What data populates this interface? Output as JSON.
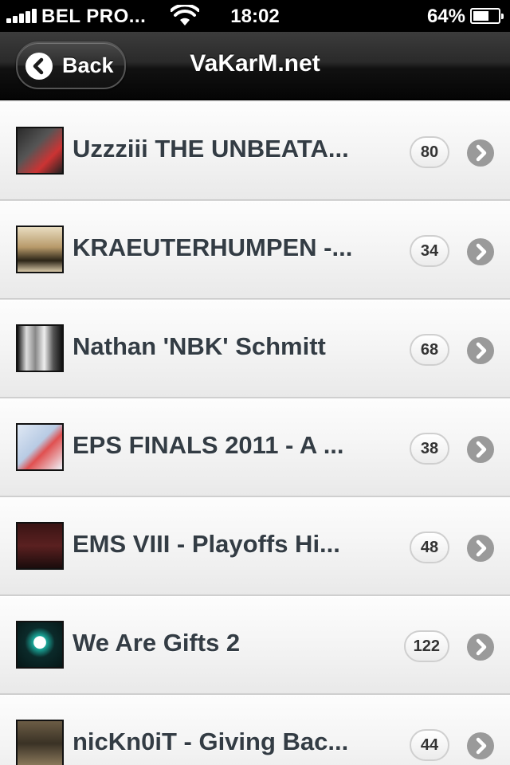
{
  "status_bar": {
    "carrier": "BEL PRO...",
    "time": "18:02",
    "battery_percent": "64%",
    "battery_level": 0.64,
    "signal_bars": 5
  },
  "header": {
    "back_label": "Back",
    "title": "VaKarM.net"
  },
  "items": [
    {
      "title": "Uzzziii THE UNBEATA...",
      "count": "80",
      "thumb_icon": "video-thumbnail-person"
    },
    {
      "title": "KRAEUTERHUMPEN -...",
      "count": "34",
      "thumb_icon": "video-thumbnail-game-scene"
    },
    {
      "title": "Nathan 'NBK' Schmitt",
      "count": "68",
      "thumb_icon": "video-thumbnail-group-photo"
    },
    {
      "title": "EPS FINALS 2011 - A ...",
      "count": "38",
      "thumb_icon": "video-thumbnail-logo"
    },
    {
      "title": "EMS VIII - Playoffs Hi...",
      "count": "48",
      "thumb_icon": "video-thumbnail-dark-scene"
    },
    {
      "title": "We Are Gifts 2",
      "count": "122",
      "thumb_icon": "video-thumbnail-team-logo"
    },
    {
      "title": "nicKn0iT - Giving Bac...",
      "count": "44",
      "thumb_icon": "video-thumbnail-game-scene"
    }
  ],
  "colors": {
    "title_text": "#333c44",
    "chevron": "#9a9a9a",
    "header_bg": "#1a1a1a"
  }
}
